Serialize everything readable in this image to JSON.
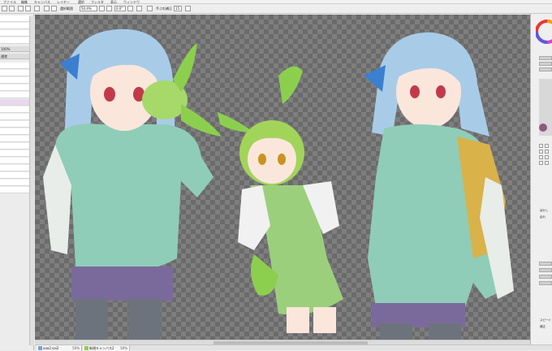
{
  "toolbar": {
    "fields": [
      "50.4%",
      "0.0°"
    ],
    "labels": [
      "選択範囲",
      "手ぶれ補正",
      "15"
    ]
  },
  "left_panel": {
    "field": "100%",
    "label": "通常"
  },
  "tabs": [
    {
      "name": "aaa2.sai2",
      "zoom": "50%"
    },
    {
      "name": "新規キャンバス2",
      "zoom": "50%"
    }
  ],
  "right_panel": {
    "labels": [
      "ぼかし",
      "乱れ",
      "スピード",
      "補正"
    ]
  },
  "colors": {
    "canvas_checker_dark": "#6b6b6b",
    "canvas_checker_light": "#7e7e7e",
    "layer_selected": "#e8d8ee",
    "panel_bg": "#ececec"
  }
}
